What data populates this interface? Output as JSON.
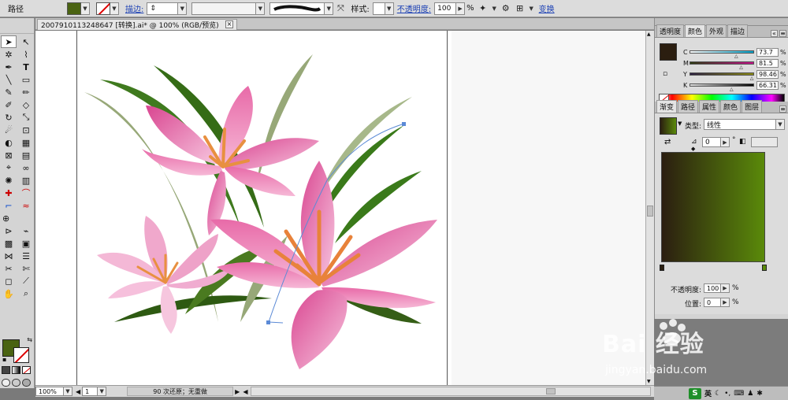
{
  "control_bar": {
    "object_type": "路径",
    "stroke_label": "描边:",
    "style_label": "样式:",
    "opacity_label": "不透明度:",
    "opacity_value": "100",
    "opacity_unit": "%",
    "transform_label": "变换",
    "fill_color": "#4a6312"
  },
  "document": {
    "tab_title": "2007910113248647 [转换].ai* @ 100% (RGB/预览)"
  },
  "status": {
    "zoom": "100%",
    "page": "1",
    "message": "90 次还原；无重做"
  },
  "color_panel": {
    "tabs": [
      "透明度",
      "颜色",
      "外观",
      "描边"
    ],
    "active_tab": "颜色",
    "swatch_color": "#2b1e10",
    "channels": [
      {
        "name": "C",
        "value": "73.7",
        "unit": "%",
        "level": 0.737,
        "colors": [
          "#ffffff",
          "#00a0c8"
        ]
      },
      {
        "name": "M",
        "value": "81.5",
        "unit": "%",
        "level": 0.815,
        "colors": [
          "#2b3a10",
          "#c8108a"
        ]
      },
      {
        "name": "Y",
        "value": "98.46",
        "unit": "%",
        "level": 0.9846,
        "colors": [
          "#2b1e40",
          "#8a8a10"
        ]
      },
      {
        "name": "K",
        "value": "66.31",
        "unit": "%",
        "level": 0.6631,
        "colors": [
          "#e0e0e0",
          "#000000"
        ]
      }
    ]
  },
  "gradient_panel": {
    "tabs": [
      "渐变",
      "路径",
      "属性",
      "颜色",
      "图层"
    ],
    "active_tab": "渐变",
    "type_label": "类型:",
    "type_value": "线性",
    "angle_value": "0",
    "angle_unit": "°",
    "start_color": "#2b1e10",
    "end_color": "#5a8a0a",
    "opacity_label": "不透明度:",
    "opacity_value": "100",
    "position_label": "位置:",
    "position_value": "0",
    "unit": "%"
  },
  "watermark": {
    "logo": "Bai 经验",
    "url": "jingyan.baidu.com"
  },
  "taskbar": {
    "ime": "英"
  }
}
